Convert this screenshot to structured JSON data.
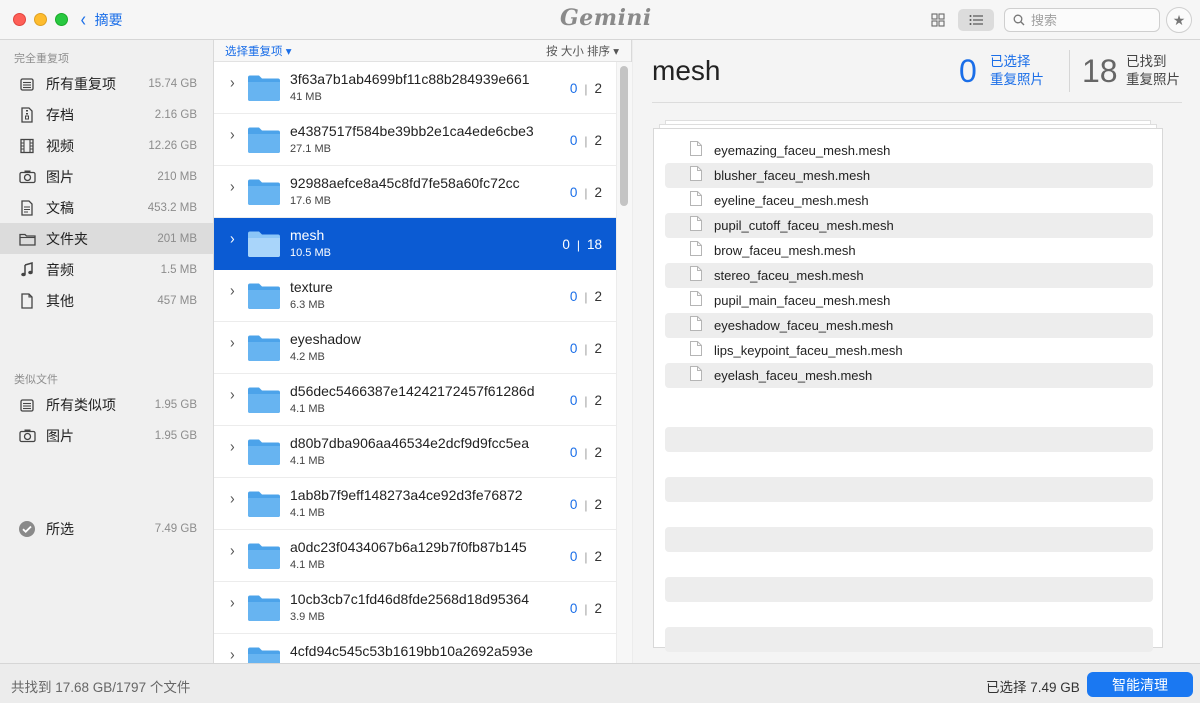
{
  "titlebar": {
    "back_label": "摘要",
    "logo": "Gemini",
    "search_placeholder": "搜索"
  },
  "sidebar": {
    "section_duplicates": "完全重复项",
    "duplicates": [
      {
        "label": "所有重复项",
        "size": "15.74 GB",
        "icon": "stack-icon"
      },
      {
        "label": "存档",
        "size": "2.16 GB",
        "icon": "archive-icon"
      },
      {
        "label": "视频",
        "size": "12.26 GB",
        "icon": "film-icon"
      },
      {
        "label": "图片",
        "size": "210 MB",
        "icon": "camera-icon"
      },
      {
        "label": "文稿",
        "size": "453.2 MB",
        "icon": "document-icon"
      },
      {
        "label": "文件夹",
        "size": "201 MB",
        "icon": "folder-icon",
        "active": true
      },
      {
        "label": "音频",
        "size": "1.5 MB",
        "icon": "music-note-icon"
      },
      {
        "label": "其他",
        "size": "457 MB",
        "icon": "file-icon"
      }
    ],
    "section_similar": "类似文件",
    "similar": [
      {
        "label": "所有类似项",
        "size": "1.95 GB",
        "icon": "stack-icon"
      },
      {
        "label": "图片",
        "size": "1.95 GB",
        "icon": "camera-icon"
      }
    ],
    "selected": {
      "label": "所选",
      "size": "7.49 GB",
      "icon": "checkmark-circle-icon"
    }
  },
  "list": {
    "select_label": "选择重复项 ▾",
    "sort_label": "按 大小 排序 ▾",
    "folders": [
      {
        "name": "3f63a7b1ab4699bf11c88b284939e661",
        "size": "41 MB",
        "selected_count": "0",
        "total": "2"
      },
      {
        "name": "e4387517f584be39bb2e1ca4ede6cbe3",
        "size": "27.1 MB",
        "selected_count": "0",
        "total": "2"
      },
      {
        "name": "92988aefce8a45c8fd7fe58a60fc72cc",
        "size": "17.6 MB",
        "selected_count": "0",
        "total": "2"
      },
      {
        "name": "mesh",
        "size": "10.5 MB",
        "selected_count": "0",
        "total": "18",
        "selected": true
      },
      {
        "name": "texture",
        "size": "6.3 MB",
        "selected_count": "0",
        "total": "2"
      },
      {
        "name": "eyeshadow",
        "size": "4.2 MB",
        "selected_count": "0",
        "total": "2"
      },
      {
        "name": "d56dec5466387e14242172457f61286d",
        "size": "4.1 MB",
        "selected_count": "0",
        "total": "2"
      },
      {
        "name": "d80b7dba906aa46534e2dcf9d9fcc5ea",
        "size": "4.1 MB",
        "selected_count": "0",
        "total": "2"
      },
      {
        "name": "1ab8b7f9eff148273a4ce92d3fe76872",
        "size": "4.1 MB",
        "selected_count": "0",
        "total": "2"
      },
      {
        "name": "a0dc23f0434067b6a129b7f0fb87b145",
        "size": "4.1 MB",
        "selected_count": "0",
        "total": "2"
      },
      {
        "name": "10cb3cb7c1fd46d8fde2568d18d95364",
        "size": "3.9 MB",
        "selected_count": "0",
        "total": "2"
      },
      {
        "name": "4cfd94c545c53b1619bb10a2692a593e",
        "size": "",
        "selected_count": "",
        "total": ""
      }
    ]
  },
  "detail": {
    "title": "mesh",
    "selected_num": "0",
    "selected_label_1": "已选择",
    "selected_label_2": "重复照片",
    "found_num": "18",
    "found_label_1": "已找到",
    "found_label_2": "重复照片",
    "files": [
      "eyemazing_faceu_mesh.mesh",
      "blusher_faceu_mesh.mesh",
      "eyeline_faceu_mesh.mesh",
      "pupil_cutoff_faceu_mesh.mesh",
      "brow_faceu_mesh.mesh",
      "stereo_faceu_mesh.mesh",
      "pupil_main_faceu_mesh.mesh",
      "eyeshadow_faceu_mesh.mesh",
      "lips_keypoint_faceu_mesh.mesh",
      "eyelash_faceu_mesh.mesh"
    ],
    "empty_rows": 10
  },
  "bottombar": {
    "found_text": "共找到 17.68 GB/1797 个文件",
    "selected_text": "已选择 7.49 GB",
    "clean_label": "智能清理"
  },
  "colors": {
    "accent": "#1a6ee8",
    "selection": "#0b5bd3",
    "button": "#1a78f2",
    "folder": "#5aaef0"
  }
}
